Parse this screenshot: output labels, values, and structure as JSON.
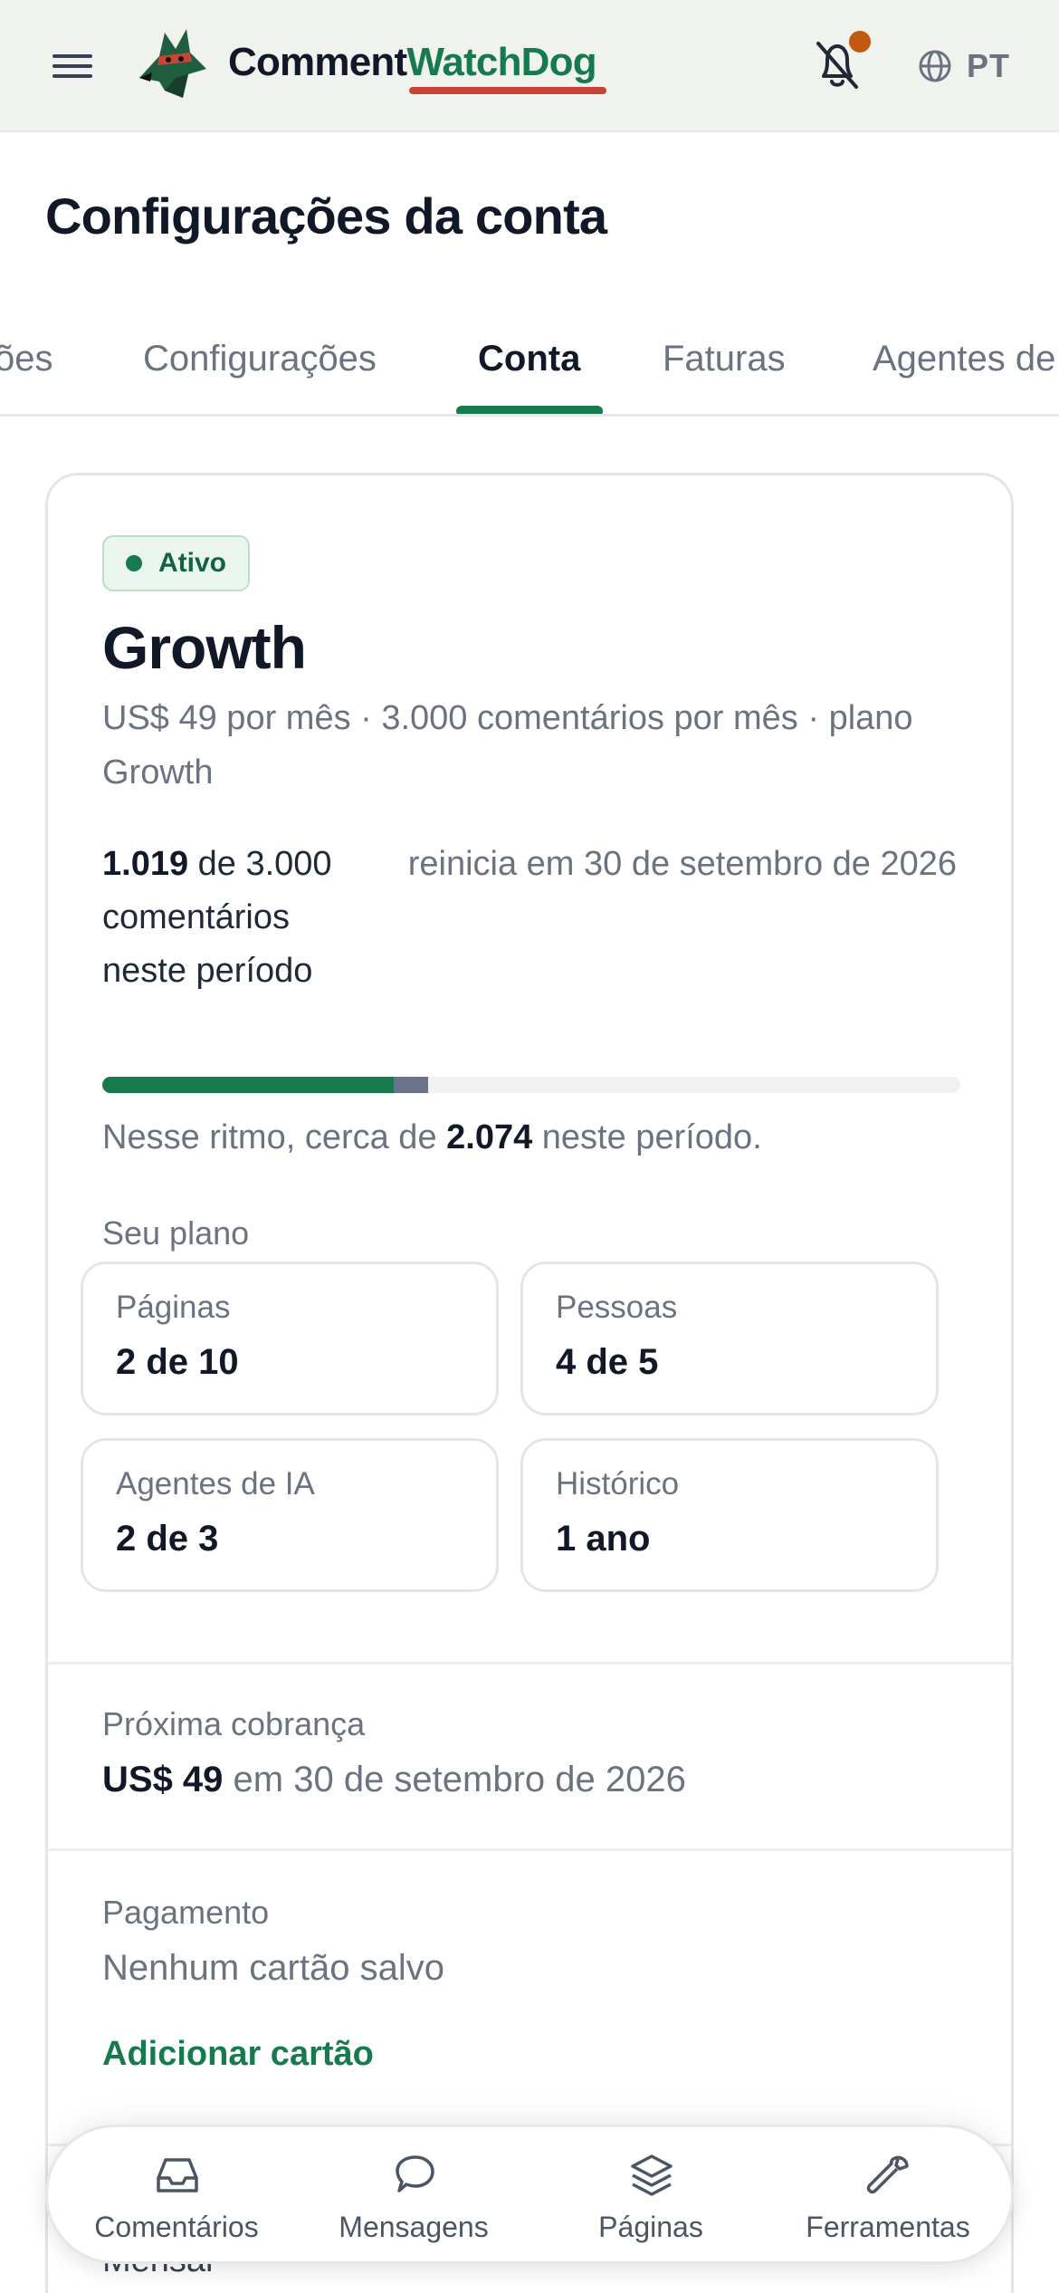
{
  "header": {
    "brand_part1": "Comment",
    "brand_part2": "WatchDog",
    "language": "PT",
    "icons": [
      "menu-icon",
      "dog-logo",
      "bell-off-icon",
      "globe-icon"
    ],
    "colors": {
      "brand_green": "#177a4d",
      "underline_red": "#c94436",
      "notification_dot": "#c2590f",
      "header_bg": "#f0f2ed"
    }
  },
  "page": {
    "title": "Configurações da conta"
  },
  "tabs": [
    {
      "label": "ões"
    },
    {
      "label": "Configurações"
    },
    {
      "label": "Conta",
      "active": true
    },
    {
      "label": "Faturas"
    },
    {
      "label": "Agentes de"
    }
  ],
  "plan": {
    "status": "Ativo",
    "name": "Growth",
    "description": "US$ 49 por mês · 3.000 comentários por mês · plano Growth",
    "usage_used": "1.019",
    "usage_rest": " de 3.000 comentários neste período",
    "reset": "reinicia em 30 de setembro de 2026",
    "progress_used": 0.3397,
    "progress_projected": 0.3797,
    "pace_prefix": "Nesse ritmo, cerca de ",
    "pace_value": "2.074",
    "pace_suffix": " neste período."
  },
  "your_plan": {
    "label": "Seu plano",
    "tiles": [
      {
        "label": "Páginas",
        "value": "2 de 10"
      },
      {
        "label": "Pessoas",
        "value": "4 de 5"
      },
      {
        "label": "Agentes de IA",
        "value": "2 de 3"
      },
      {
        "label": "Histórico",
        "value": "1 ano"
      }
    ]
  },
  "billing": {
    "next_label": "Próxima cobrança",
    "next_amount": "US$ 49",
    "next_date": " em 30 de setembro de 2026",
    "payment_label": "Pagamento",
    "payment_value": "Nenhum cartão salvo",
    "add_card": "Adicionar cartão",
    "partial_below": "Mensal"
  },
  "bottom_nav": [
    {
      "label": "Comentários",
      "icon": "inbox-icon"
    },
    {
      "label": "Mensagens",
      "icon": "chat-bubble-icon"
    },
    {
      "label": "Páginas",
      "icon": "layers-icon"
    },
    {
      "label": "Ferramentas",
      "icon": "wrench-icon"
    }
  ]
}
